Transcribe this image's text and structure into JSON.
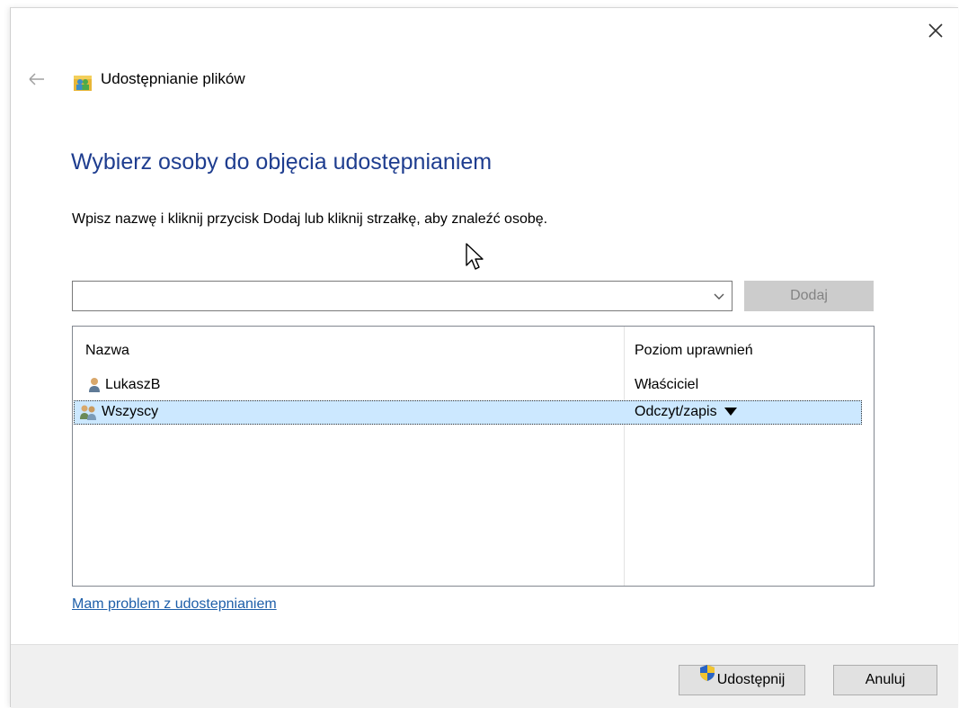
{
  "window": {
    "title": "Udostępnianie plików",
    "close_icon": "close-icon",
    "back_icon": "back-arrow-icon"
  },
  "main": {
    "heading": "Wybierz osoby do objęcia udostępnianiem",
    "instruction": "Wpisz nazwę i kliknij przycisk Dodaj lub kliknij strzałkę, aby znaleźć osobę.",
    "combo": {
      "value": "",
      "placeholder": ""
    },
    "add_label": "Dodaj"
  },
  "table": {
    "columns": [
      "Nazwa",
      "Poziom uprawnień"
    ],
    "rows": [
      {
        "name": "LukaszB",
        "permission": "Właściciel",
        "icon": "user-icon"
      },
      {
        "name": "Wszyscy",
        "permission": "Odczyt/zapis",
        "icon": "users-group-icon",
        "selected": true
      }
    ]
  },
  "help_link": "Mam problem z udostepnianiem",
  "footer": {
    "share_label": "Udostępnij",
    "cancel_label": "Anuluj"
  },
  "colors": {
    "heading": "#1e3d8f",
    "link": "#1e5fa9",
    "selection": "#cce8ff",
    "footer_bg": "#f0f0f0"
  }
}
